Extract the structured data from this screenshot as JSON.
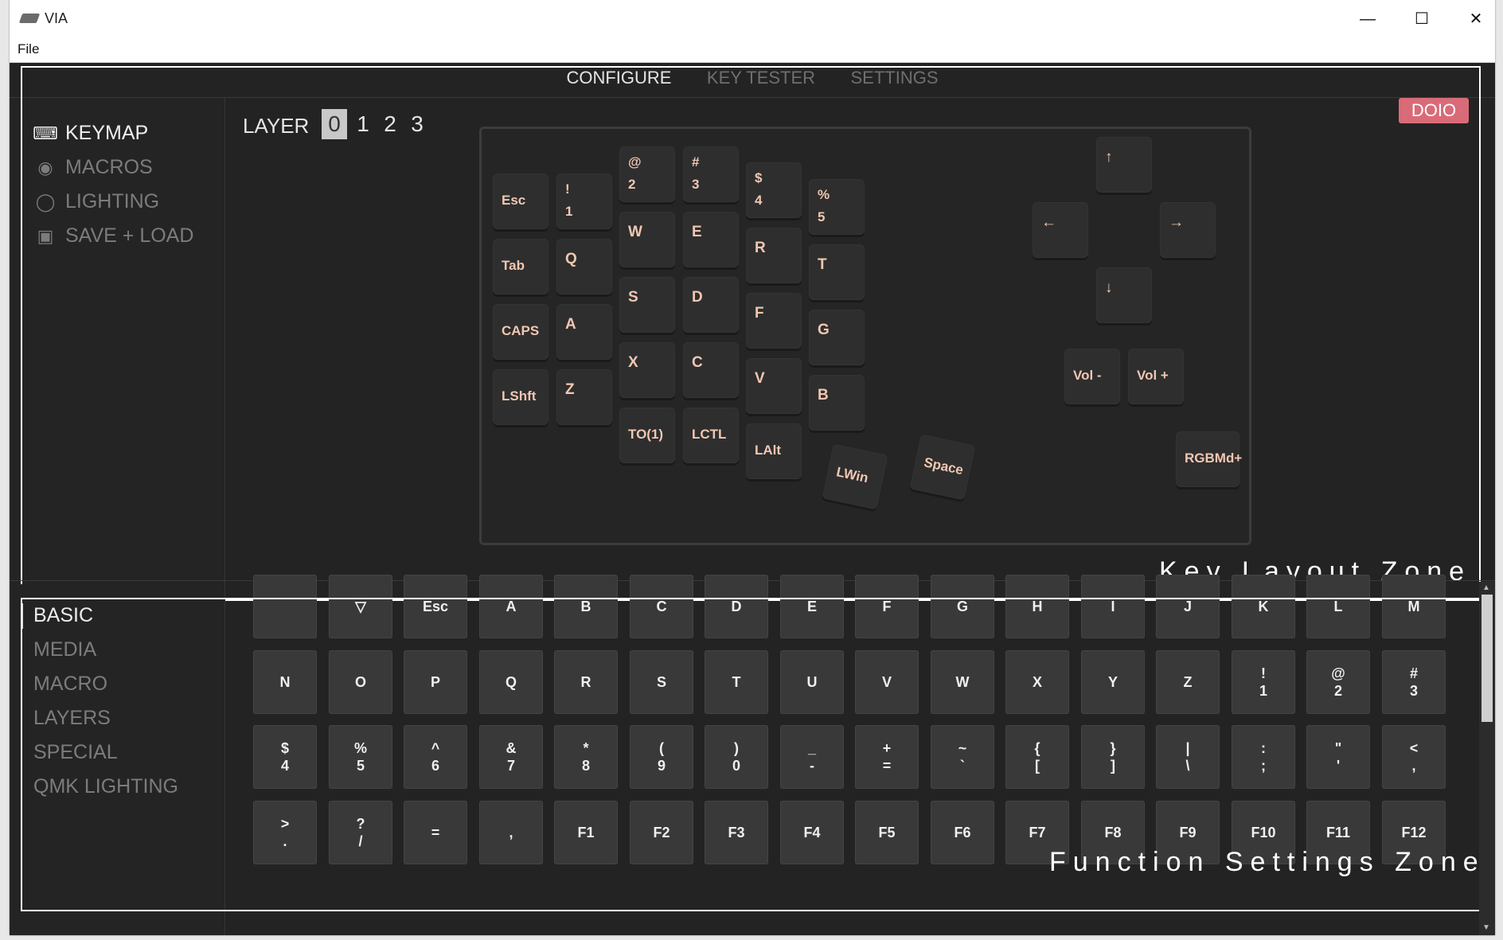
{
  "window": {
    "title": "VIA",
    "menu": [
      "File"
    ]
  },
  "topnav": {
    "tabs": [
      "CONFIGURE",
      "KEY TESTER",
      "SETTINGS"
    ]
  },
  "sidebar": {
    "items": [
      "KEYMAP",
      "MACROS",
      "LIGHTING",
      "SAVE + LOAD"
    ]
  },
  "layer": {
    "label": "LAYER",
    "numbers": [
      "0",
      "1",
      "2",
      "3"
    ],
    "selected": "0"
  },
  "badge": "DOIO",
  "keyboard": {
    "keys": [
      "Esc",
      "!\n1",
      "@\n2",
      "#\n3",
      "$\n4",
      "%\n5",
      "Tab",
      "Q",
      "W",
      "E",
      "R",
      "T",
      "CAPS",
      "A",
      "S",
      "D",
      "F",
      "G",
      "LShft",
      "Z",
      "X",
      "C",
      "V",
      "B",
      "TO(1)",
      "LCTL",
      "LAlt",
      "LWin",
      "Space",
      "↑",
      "←",
      "→",
      "↓",
      "Vol -",
      "Vol +",
      "RGBMd+"
    ]
  },
  "zones": {
    "top": "Key Layout Zone",
    "bottom": "Function Settings Zone"
  },
  "functions": {
    "categories": [
      "BASIC",
      "MEDIA",
      "MACRO",
      "LAYERS",
      "SPECIAL",
      "QMK LIGHTING"
    ],
    "selected": "BASIC",
    "keys": [
      "",
      "▽",
      "Esc",
      "A",
      "B",
      "C",
      "D",
      "E",
      "F",
      "G",
      "H",
      "I",
      "J",
      "K",
      "L",
      "M",
      "N",
      "O",
      "P",
      "Q",
      "R",
      "S",
      "T",
      "U",
      "V",
      "W",
      "X",
      "Y",
      "Z",
      "!\n1",
      "@\n2",
      "#\n3",
      "$\n4",
      "%\n5",
      "^\n6",
      "&\n7",
      "*\n8",
      "(\n9",
      ")\n0",
      "_\n-",
      "+\n=",
      "~\n`",
      "{\n[",
      "}\n]",
      "|\n\\",
      ":\n;",
      "\"\n'",
      "<\n,",
      ">\n.",
      "?\n/",
      "=",
      ",",
      "F1",
      "F2",
      "F3",
      "F4",
      "F5",
      "F6",
      "F7",
      "F8",
      "F9",
      "F10",
      "F11",
      "F12"
    ]
  },
  "colors": {
    "background": "#232323",
    "key_legend": "#f1c7b2",
    "badge": "#d96b78"
  }
}
